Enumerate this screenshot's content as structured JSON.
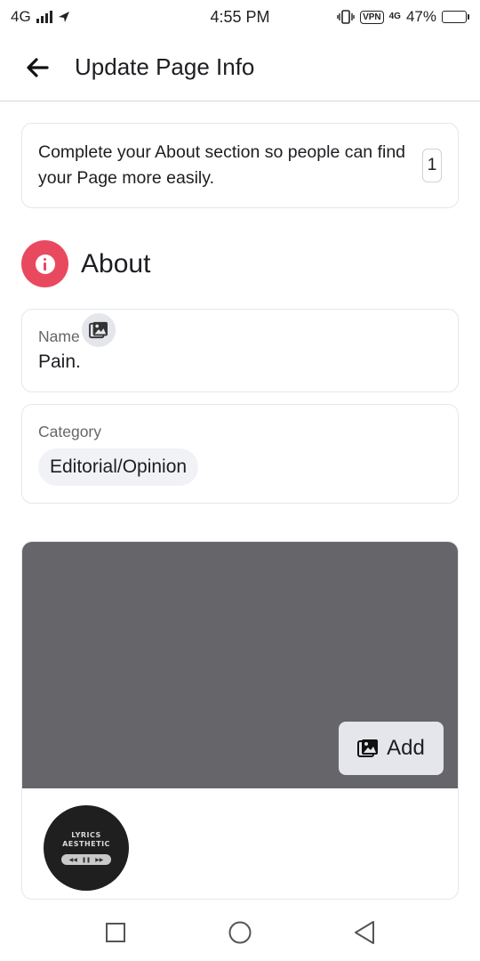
{
  "status_bar": {
    "network": "4G",
    "time": "4:55 PM",
    "vpn": "VPN",
    "network_small": "4G",
    "battery_percent": "47%",
    "battery_level": 0.47
  },
  "header": {
    "title": "Update Page Info",
    "back_icon": "arrow-left-icon"
  },
  "notice": {
    "text": "Complete your About section so people can find your Page more easily.",
    "count": "1"
  },
  "about": {
    "title": "About",
    "icon": "info-icon",
    "icon_color": "#e9495f"
  },
  "fields": {
    "name": {
      "label": "Name",
      "value": "Pain."
    },
    "category": {
      "label": "Category",
      "value": "Editorial/Opinion"
    }
  },
  "cover": {
    "background": "#65656a",
    "add_label": "Add",
    "add_icon": "photo-icon"
  },
  "profile": {
    "text_line1": "Lyrics",
    "text_line2": "Aesthetic",
    "camera_icon": "photo-icon"
  },
  "nav": {
    "recents_icon": "square-icon",
    "home_icon": "circle-icon",
    "back_icon": "triangle-back-icon"
  }
}
